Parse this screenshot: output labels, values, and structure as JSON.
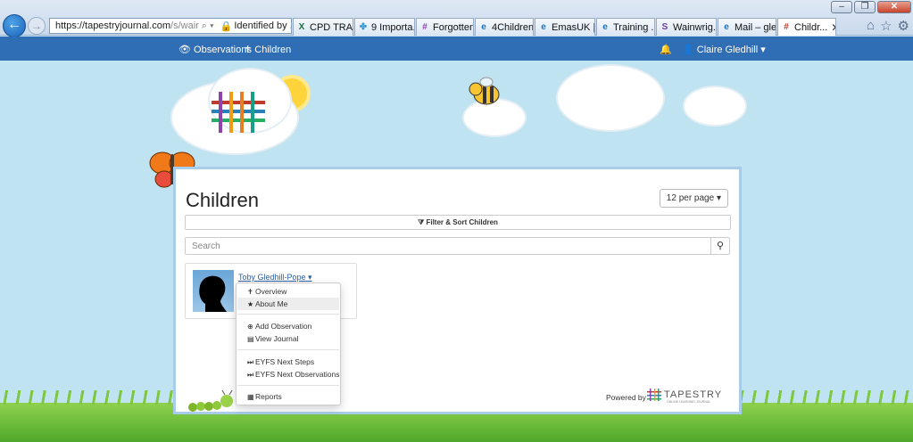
{
  "browser": {
    "address_url": "https://tapestryjournal.com",
    "address_url_rest": "/s/wair",
    "identity": "Identified by ...",
    "tabs": [
      {
        "label": "CPD TRA...",
        "icon": "X",
        "color": "#1d6f42",
        "active": false
      },
      {
        "label": "9 Importa...",
        "icon": "✤",
        "color": "#3a9ad9",
        "active": false
      },
      {
        "label": "Forgotten...",
        "icon": "#",
        "color": "#8e44ad",
        "active": false
      },
      {
        "label": "4Children...",
        "icon": "e",
        "color": "#1e73be",
        "active": false
      },
      {
        "label": "EmasUK |...",
        "icon": "e",
        "color": "#1e73be",
        "active": false
      },
      {
        "label": "Training ...",
        "icon": "e",
        "color": "#1e73be",
        "active": false
      },
      {
        "label": "Wainwrig...",
        "icon": "S",
        "color": "#6b3fa0",
        "active": false
      },
      {
        "label": "Mail – gle...",
        "icon": "e",
        "color": "#1e73be",
        "active": false
      },
      {
        "label": "Childr...",
        "icon": "#",
        "color": "#c0392b",
        "active": true
      }
    ],
    "window_controls": {
      "minimize": "–",
      "restore": "❐",
      "close": "✕"
    }
  },
  "navbar": {
    "observations": "Observations",
    "children": "Children",
    "user": "Claire Gledhill"
  },
  "main": {
    "title": "Children",
    "per_page": "12 per page",
    "filter": "Filter & Sort Children",
    "search_placeholder": "Search",
    "child_name": "Toby Gledhill-Pope",
    "menu": {
      "overview": "Overview",
      "about_me": "About Me",
      "add_observation": "Add Observation",
      "view_journal": "View Journal",
      "eyfs_next_steps": "EYFS Next Steps",
      "eyfs_next_observations": "EYFS Next Observations",
      "reports": "Reports"
    },
    "powered_by": "Powered by",
    "logo_text": "TAPESTRY",
    "logo_sub": "ONLINE LEARNING JOURNAL"
  },
  "colors": {
    "navbar": "#2f6db5",
    "sky": "#bfe3f1",
    "link": "#2c5fa8",
    "panel_border": "#a8cce9"
  }
}
